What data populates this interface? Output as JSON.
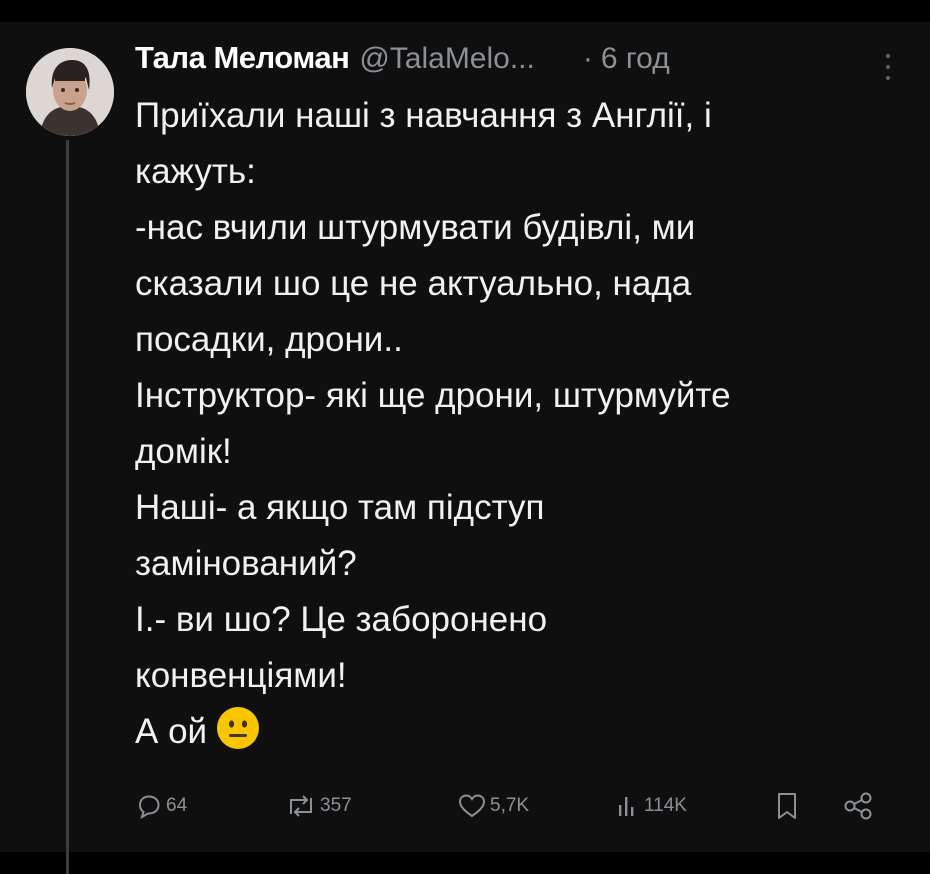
{
  "post": {
    "author_name": "Тала Меломан",
    "handle": "@TalaMelo...",
    "separator": "·",
    "time": "6 год",
    "body_lines": [
      "Приїхали наші з навчання з Англії, і",
      "кажуть:",
      "-нас вчили штурмувати будівлі, ми",
      "сказали шо це не актуально, нада",
      "посадки, дрони..",
      "Інструктор- які ще дрони, штурмуйте",
      "домік!",
      "Наші- а якщо там підступ",
      "замінований?",
      "І.- ви шо? Це заборонено",
      "конвенціями!",
      "А ой"
    ],
    "last_line_emoji": "neutral-face-emoji"
  },
  "actions": {
    "replies": "64",
    "reposts": "357",
    "likes": "5,7K",
    "views": "114K"
  },
  "colors": {
    "background": "#0f0f10",
    "text": "#f1f1f1",
    "muted": "#8b9097",
    "emoji": "#f7c600"
  }
}
